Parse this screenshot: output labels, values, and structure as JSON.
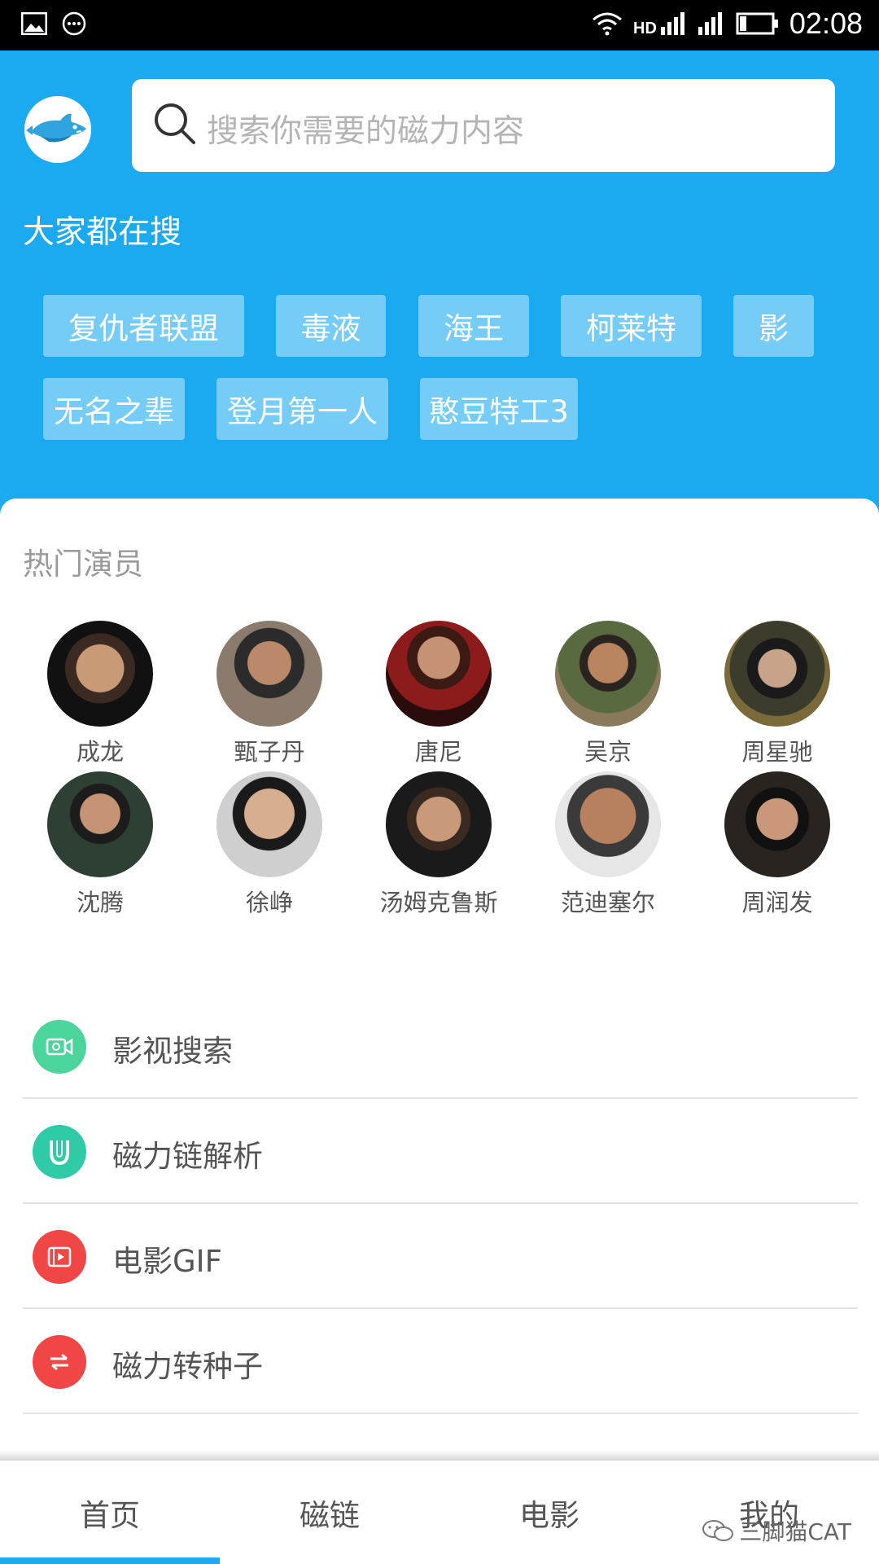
{
  "status_bar": {
    "time": "02:08",
    "icons": [
      "image-icon",
      "more-dots-icon",
      "wifi-icon",
      "hd-signal-icon",
      "signal-icon",
      "battery-icon"
    ]
  },
  "search": {
    "placeholder": "搜索你需要的磁力内容"
  },
  "hot_searches": {
    "title": "大家都在搜",
    "tags": [
      "复仇者联盟",
      "毒液",
      "海王",
      "柯莱特",
      "影",
      "无名之辈",
      "登月第一人",
      "憨豆特工3"
    ]
  },
  "actors": {
    "title": "热门演员",
    "items": [
      "成龙",
      "甄子丹",
      "唐尼",
      "吴京",
      "周星驰",
      "沈腾",
      "徐峥",
      "汤姆克鲁斯",
      "范迪塞尔",
      "周润发"
    ]
  },
  "menu": [
    {
      "label": "影视搜索",
      "icon": "video-camera-icon",
      "color": "#4CD59A"
    },
    {
      "label": "磁力链解析",
      "icon": "magnet-icon",
      "color": "#2ECBA6"
    },
    {
      "label": "电影GIF",
      "icon": "film-icon",
      "color": "#F04646"
    },
    {
      "label": "磁力转种子",
      "icon": "swap-arrows-icon",
      "color": "#F04646"
    }
  ],
  "bottom_nav": {
    "tabs": [
      "首页",
      "磁链",
      "电影",
      "我的"
    ],
    "active": 0
  },
  "watermark": "三脚猫CAT",
  "colors": {
    "primary": "#1BA9F0",
    "tag_bg": "#74CCF7"
  }
}
